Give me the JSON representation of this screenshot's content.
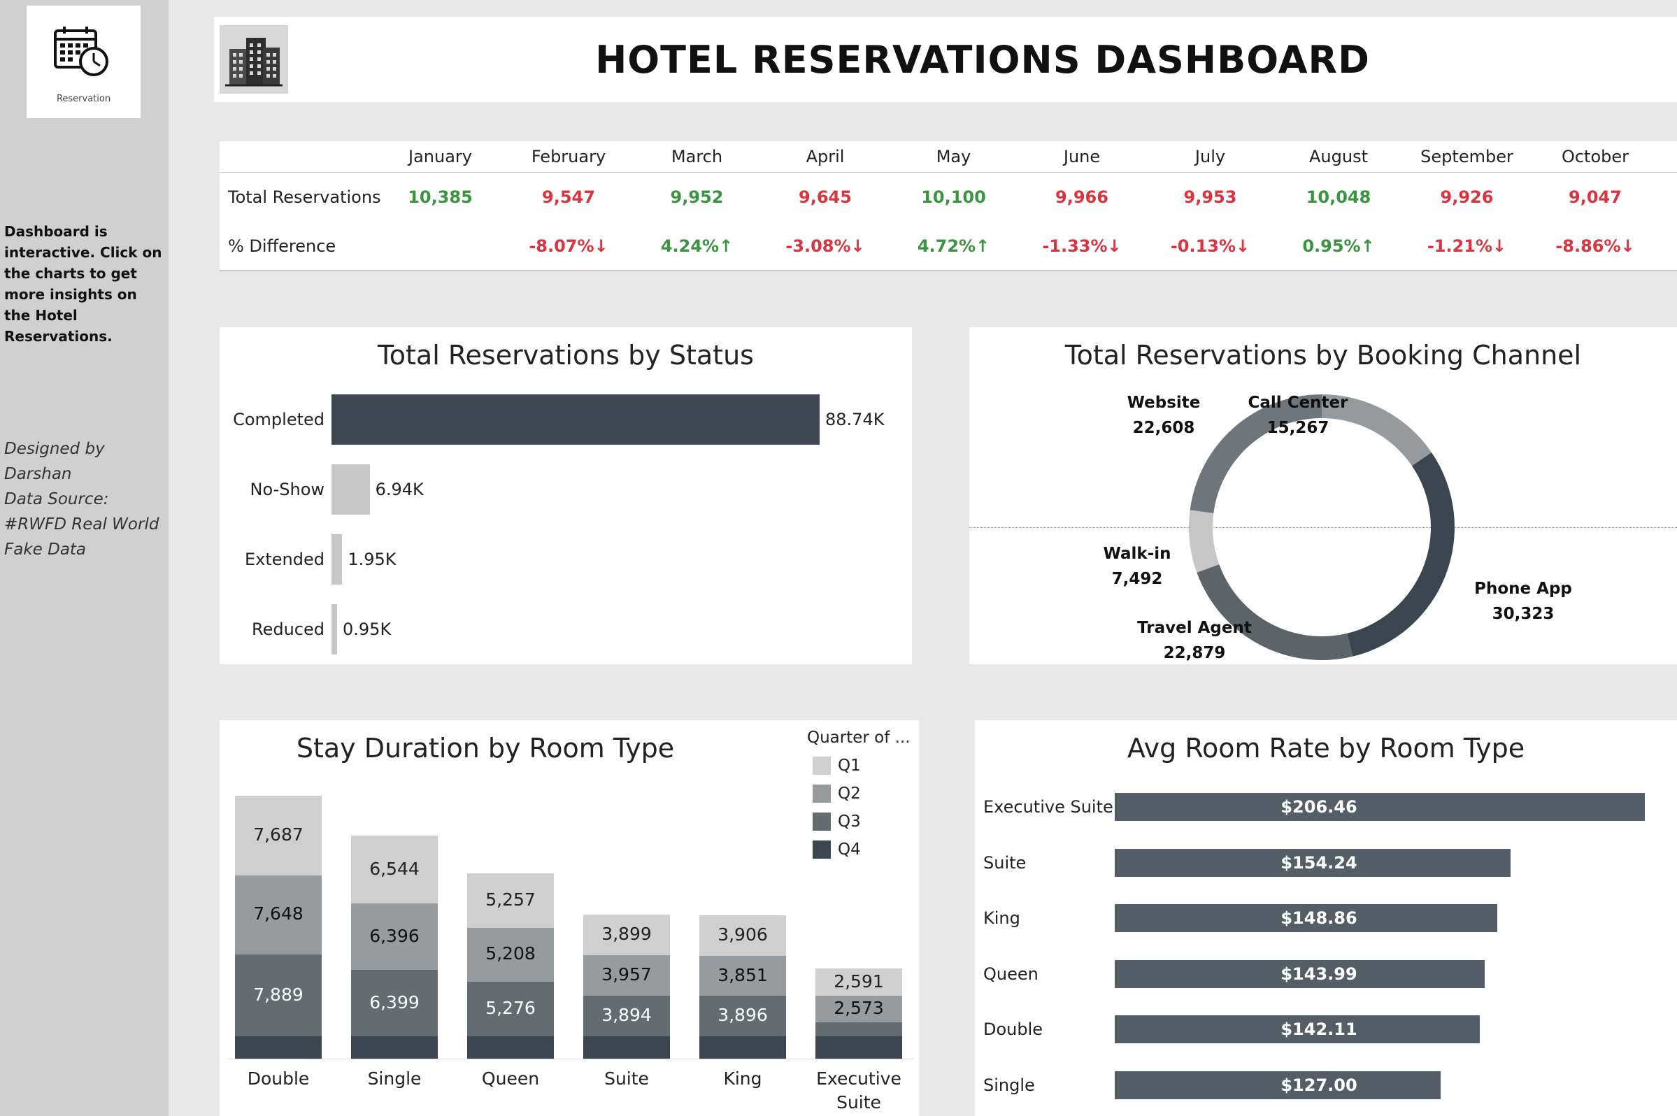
{
  "sidebar": {
    "logo_caption": "Reservation",
    "note": "Dashboard is interactive. Click on the charts to get more insights on the Hotel Reservations.",
    "credits": [
      "Designed by",
      "Darshan",
      "Data Source:",
      "#RWFD Real World",
      "Fake Data"
    ]
  },
  "header": {
    "title": "HOTEL RESERVATIONS DASHBOARD"
  },
  "kpi": {
    "row1_label": "Total Reservations",
    "row2_label": "% Difference",
    "months": [
      "January",
      "February",
      "March",
      "April",
      "May",
      "June",
      "July",
      "August",
      "September",
      "October"
    ],
    "totals": [
      "10,385",
      "9,547",
      "9,952",
      "9,645",
      "10,100",
      "9,966",
      "9,953",
      "10,048",
      "9,926",
      "9,047"
    ],
    "total_trend": [
      "up",
      "down",
      "up",
      "down",
      "up",
      "down",
      "down",
      "up",
      "down",
      "down"
    ],
    "diffs": [
      "",
      "-8.07%↓",
      "4.24%↑",
      "-3.08%↓",
      "4.72%↑",
      "-1.33%↓",
      "-0.13%↓",
      "0.95%↑",
      "-1.21%↓",
      "-8.86%↓"
    ],
    "colors": {
      "up": "#3a9440",
      "down": "#d9353f"
    }
  },
  "status_chart": {
    "title": "Total Reservations by Status",
    "chart_data": {
      "type": "bar",
      "orientation": "horizontal",
      "categories": [
        "Completed",
        "No-Show",
        "Extended",
        "Reduced"
      ],
      "values": [
        88740,
        6940,
        1950,
        950
      ],
      "labels": [
        "88.74K",
        "6.94K",
        "1.95K",
        "0.95K"
      ],
      "colors": [
        "#3f4852",
        "#c6c6c6",
        "#c6c6c6",
        "#c6c6c6"
      ]
    }
  },
  "channel_chart": {
    "title": "Total Reservations by Booking Channel",
    "chart_data": {
      "type": "pie",
      "donut": true,
      "categories": [
        "Call Center",
        "Phone App",
        "Travel Agent",
        "Walk-in",
        "Website"
      ],
      "values": [
        15267,
        30323,
        22879,
        7492,
        22608
      ],
      "labels": [
        "15,267",
        "30,323",
        "22,879",
        "7,492",
        "22,608"
      ],
      "colors": [
        "#969a9c",
        "#3b4651",
        "#5c6468",
        "#c6c6c6",
        "#6e767c"
      ]
    }
  },
  "stay_chart": {
    "title": "Stay Duration by Room Type",
    "legend_title": "Quarter of ...",
    "chart_data": {
      "type": "bar",
      "stacked": true,
      "categories": [
        "Double",
        "Single",
        "Queen",
        "Suite",
        "King",
        "Executive Suite"
      ],
      "series": [
        {
          "name": "Q1",
          "color": "#cfcfcf",
          "text_color": "#222222",
          "values": [
            7687,
            6544,
            5257,
            3899,
            3906,
            2591
          ]
        },
        {
          "name": "Q2",
          "color": "#979b9d",
          "text_color": "#111111",
          "values": [
            7648,
            6396,
            5208,
            3957,
            3851,
            2573
          ]
        },
        {
          "name": "Q3",
          "color": "#646c72",
          "text_color": "#ffffff",
          "values": [
            7889,
            6399,
            5276,
            3894,
            3896,
            null
          ]
        },
        {
          "name": "Q4",
          "color": "#3b4651",
          "text_color": "#ffffff",
          "values": [
            null,
            null,
            null,
            null,
            null,
            null
          ]
        }
      ]
    }
  },
  "rate_chart": {
    "title": "Avg Room Rate by Room Type",
    "chart_data": {
      "type": "bar",
      "orientation": "horizontal",
      "categories": [
        "Executive Suite",
        "Suite",
        "King",
        "Queen",
        "Double",
        "Single"
      ],
      "values": [
        206.46,
        154.24,
        148.86,
        143.99,
        142.11,
        127.0
      ],
      "labels": [
        "$206.46",
        "$154.24",
        "$148.86",
        "$143.99",
        "$142.11",
        "$127.00"
      ],
      "color": "#555e66"
    }
  }
}
